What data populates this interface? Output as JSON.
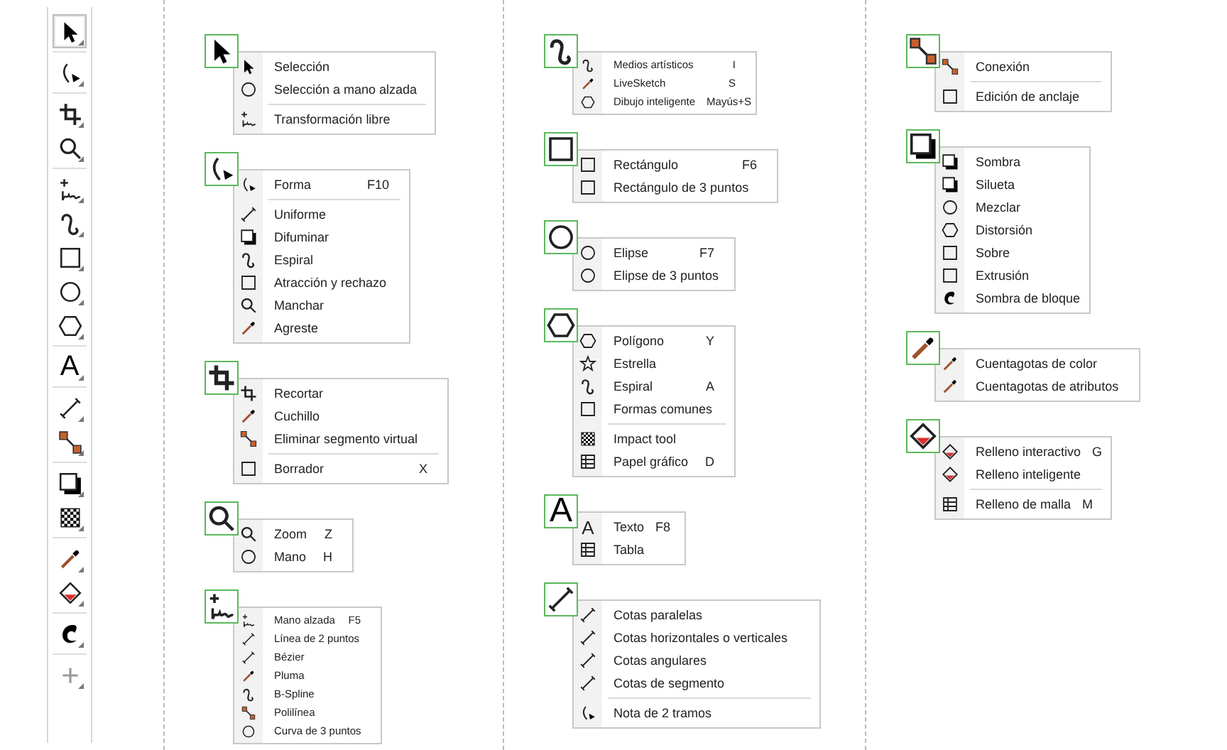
{
  "toolbar": {
    "groups": [
      {
        "tools": [
          {
            "selected": true
          }
        ]
      },
      {
        "tools": [
          {
            "selected": false
          }
        ]
      },
      {
        "tools": [
          {
            "selected": false
          },
          {
            "selected": false
          }
        ]
      },
      {
        "tools": [
          {
            "selected": false
          },
          {
            "selected": false
          },
          {
            "selected": false
          },
          {
            "selected": false
          },
          {
            "selected": false
          }
        ]
      },
      {
        "tools": [
          {
            "selected": false,
            "glyph": "A"
          }
        ]
      },
      {
        "tools": [
          {
            "selected": false
          },
          {
            "selected": false
          }
        ]
      },
      {
        "tools": [
          {
            "selected": false
          },
          {
            "selected": false
          }
        ]
      },
      {
        "tools": [
          {
            "selected": false
          },
          {
            "selected": false
          }
        ]
      },
      {
        "tools": [
          {
            "selected": false
          }
        ]
      },
      {
        "tools": [
          {
            "selected": false
          }
        ]
      }
    ]
  },
  "columns": [
    {
      "groups": [
        {
          "items": [
            {
              "label": "Selección"
            },
            {
              "label": "Selección a mano alzada"
            },
            {
              "label": "Transformación libre",
              "divider_above": true
            }
          ]
        },
        {
          "items": [
            {
              "label": "Forma",
              "shortcut": "F10"
            },
            {
              "label": "Uniforme",
              "divider_above": true
            },
            {
              "label": "Difuminar"
            },
            {
              "label": "Espiral"
            },
            {
              "label": "Atracción y rechazo"
            },
            {
              "label": "Manchar"
            },
            {
              "label": "Agreste"
            }
          ]
        },
        {
          "items": [
            {
              "label": "Recortar"
            },
            {
              "label": "Cuchillo"
            },
            {
              "label": "Eliminar segmento virtual"
            },
            {
              "label": "Borrador",
              "shortcut": "X",
              "divider_above": true
            }
          ]
        },
        {
          "items": [
            {
              "label": "Zoom",
              "shortcut": "Z"
            },
            {
              "label": "Mano",
              "shortcut": "H"
            }
          ]
        },
        {
          "items": [
            {
              "label": "Mano alzada",
              "shortcut": "F5"
            },
            {
              "label": "Línea de 2 puntos"
            },
            {
              "label": "Bézier"
            },
            {
              "label": "Pluma"
            },
            {
              "label": "B-Spline"
            },
            {
              "label": "Polilínea"
            },
            {
              "label": "Curva de 3 puntos"
            }
          ]
        }
      ]
    },
    {
      "groups": [
        {
          "items": [
            {
              "label": "Medios artísticos",
              "shortcut": "I"
            },
            {
              "label": "LiveSketch",
              "shortcut": "S"
            },
            {
              "label": "Dibujo inteligente",
              "shortcut": "Mayús+S"
            }
          ]
        },
        {
          "items": [
            {
              "label": "Rectángulo",
              "shortcut": "F6"
            },
            {
              "label": "Rectángulo de 3 puntos"
            }
          ]
        },
        {
          "items": [
            {
              "label": "Elipse",
              "shortcut": "F7"
            },
            {
              "label": "Elipse de 3 puntos"
            }
          ]
        },
        {
          "items": [
            {
              "label": "Polígono",
              "shortcut": "Y"
            },
            {
              "label": "Estrella"
            },
            {
              "label": "Espiral",
              "shortcut": "A"
            },
            {
              "label": "Formas comunes"
            },
            {
              "label": "Impact tool",
              "divider_above": true
            },
            {
              "label": "Papel gráfico",
              "shortcut": "D"
            }
          ]
        },
        {
          "glyph": "A",
          "items": [
            {
              "label": "Texto",
              "shortcut": "F8",
              "glyph": "A"
            },
            {
              "label": "Tabla"
            }
          ]
        },
        {
          "items": [
            {
              "label": "Cotas paralelas"
            },
            {
              "label": "Cotas horizontales o verticales"
            },
            {
              "label": "Cotas angulares"
            },
            {
              "label": "Cotas de segmento"
            },
            {
              "label": "Nota de 2 tramos",
              "divider_above": true
            }
          ]
        }
      ]
    },
    {
      "groups": [
        {
          "items": [
            {
              "label": "Conexión"
            },
            {
              "label": "Edición de anclaje",
              "divider_above": true
            }
          ]
        },
        {
          "items": [
            {
              "label": "Sombra"
            },
            {
              "label": "Silueta"
            },
            {
              "label": "Mezclar"
            },
            {
              "label": "Distorsión"
            },
            {
              "label": "Sobre"
            },
            {
              "label": "Extrusión"
            },
            {
              "label": "Sombra de bloque"
            }
          ]
        },
        {
          "items": [
            {
              "label": "Cuentagotas de color"
            },
            {
              "label": "Cuentagotas de atributos"
            }
          ]
        },
        {
          "items": [
            {
              "label": "Relleno interactivo",
              "shortcut": "G"
            },
            {
              "label": "Relleno inteligente"
            },
            {
              "label": "Relleno de malla",
              "shortcut": "M",
              "divider_above": true
            }
          ]
        }
      ]
    }
  ]
}
